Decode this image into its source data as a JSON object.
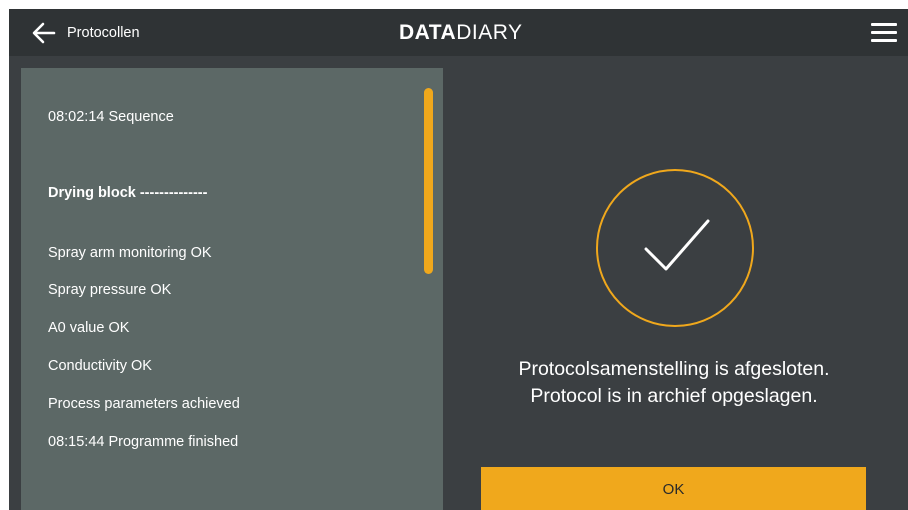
{
  "header": {
    "back_label": "Protocollen",
    "logo_bold": "DATA",
    "logo_light": "DIARY"
  },
  "log": {
    "lines": [
      "08:02:14 Sequence",
      "Drying block --------------",
      "Spray arm monitoring OK",
      "Spray pressure OK",
      "A0 value OK",
      "Conductivity OK",
      "Process parameters achieved",
      "08:15:44 Programme finished"
    ]
  },
  "confirmation": {
    "line1": "Protocolsamenstelling is afgesloten.",
    "line2": "Protocol is in archief opgeslagen.",
    "ok_label": "OK"
  },
  "colors": {
    "accent": "#f0a81c",
    "topbar": "#2f3335",
    "background": "#3b3f42",
    "panel": "#5c6866"
  },
  "icons": {
    "back": "arrow-left-icon",
    "menu": "hamburger-menu-icon",
    "success": "checkmark-icon"
  }
}
